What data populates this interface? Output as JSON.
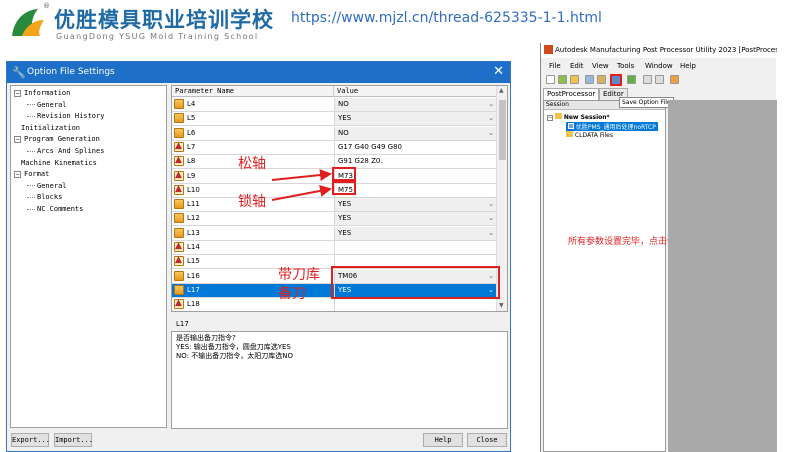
{
  "header": {
    "school_name": "优胜模具职业培训学校",
    "school_sub": "GuangDong YSUG Mold Training School",
    "url": "https://www.mjzl.cn/thread-625335-1-1.html",
    "registered_mark": "®"
  },
  "dialog": {
    "title": "Option File Settings",
    "close_glyph": "✕",
    "tree": [
      {
        "label": "Information",
        "level": 0,
        "expander": "−"
      },
      {
        "label": "General",
        "level": 2
      },
      {
        "label": "Revision History",
        "level": 2
      },
      {
        "label": "Initialization",
        "level": 1
      },
      {
        "label": "Program Generation",
        "level": 0,
        "expander": "−"
      },
      {
        "label": "Arcs And Splines",
        "level": 2
      },
      {
        "label": "Machine Kinematics",
        "level": 1
      },
      {
        "label": "Format",
        "level": 0,
        "expander": "−"
      },
      {
        "label": "General",
        "level": 2
      },
      {
        "label": "Blocks",
        "level": 2
      },
      {
        "label": "NC Comments",
        "level": 2
      }
    ],
    "grid": {
      "col_name": "Parameter Name",
      "col_value": "Value",
      "rows": [
        {
          "icon": "folder",
          "name": "L4",
          "value": "NO",
          "combo": true
        },
        {
          "icon": "folder",
          "name": "L5",
          "value": "YES",
          "combo": true
        },
        {
          "icon": "folder",
          "name": "L6",
          "value": "NO",
          "combo": true
        },
        {
          "icon": "alert",
          "name": "L7",
          "value": "G17 G40 G49 G80",
          "combo": false
        },
        {
          "icon": "alert",
          "name": "L8",
          "value": "G91 G28 Z0.",
          "combo": false
        },
        {
          "icon": "alert",
          "name": "L9",
          "value": "M73",
          "combo": false
        },
        {
          "icon": "alert",
          "name": "L10",
          "value": "M75",
          "combo": false
        },
        {
          "icon": "folder",
          "name": "L11",
          "value": "YES",
          "combo": true
        },
        {
          "icon": "folder",
          "name": "L12",
          "value": "YES",
          "combo": true
        },
        {
          "icon": "folder",
          "name": "L13",
          "value": "YES",
          "combo": true
        },
        {
          "icon": "alert",
          "name": "L14",
          "value": "",
          "combo": false
        },
        {
          "icon": "alert",
          "name": "L15",
          "value": "",
          "combo": false
        },
        {
          "icon": "folder",
          "name": "L16",
          "value": "TM06",
          "combo": true
        },
        {
          "icon": "folder",
          "name": "L17",
          "value": "YES",
          "combo": true,
          "selected": true
        },
        {
          "icon": "alert",
          "name": "L18",
          "value": "",
          "combo": false
        }
      ]
    },
    "desc_label": "L17",
    "desc_lines": [
      "是否输出备刀指令?",
      "YES: 输出备刀指令，圆盘刀库选YES",
      "NO: 不输出备刀指令，太阳刀库选NO"
    ],
    "buttons": {
      "export": "Export...",
      "import": "Import...",
      "help": "Help",
      "close": "Close"
    }
  },
  "annotations": {
    "loosen": "松轴",
    "lock": "锁轴",
    "with_magazine": "带刀库",
    "prep_tool": "备刀",
    "save_hint": "所有参数设置完毕，点击保存"
  },
  "post_window": {
    "title": "Autodesk Manufacturing Post Processor Utility 2023 [PostProcessors.Ne",
    "menu": [
      "File",
      "Edit",
      "View",
      "Tools",
      "Window",
      "Help"
    ],
    "tabs": [
      "PostProcessor",
      "Editor"
    ],
    "tooltip": "Save Option File",
    "session_header": "Session",
    "session_items": [
      {
        "label": "New Session*",
        "level": 0
      },
      {
        "label": "优胜PMS_通用后处理noRTCP",
        "level": 1,
        "selected": true
      },
      {
        "label": "CLDATA Files",
        "level": 1
      }
    ]
  },
  "colors": {
    "accent": "#1d6fc7",
    "annotation_red": "#e02020",
    "selection": "#0078d7"
  }
}
